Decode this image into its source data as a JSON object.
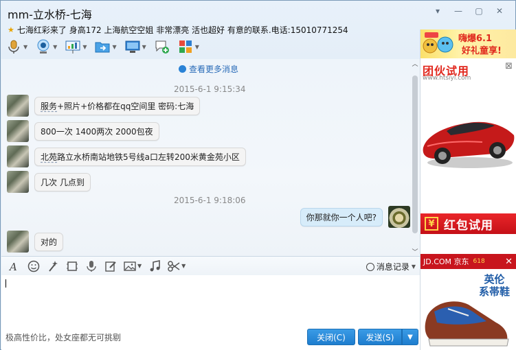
{
  "window": {
    "title": "mm-立水桥-七海",
    "controls": [
      "▾",
      "—",
      "▢",
      "✕"
    ]
  },
  "contact": {
    "signature": "七海红彩来了 身高172 上海航空空姐 非常漂亮 活也超好 有意的联系.电话:15010771254"
  },
  "toolbar": {
    "items": [
      "voice-call",
      "video-call",
      "share-screen",
      "send-file",
      "remote-desktop",
      "create-discussion",
      "apps"
    ]
  },
  "chat": {
    "more_messages": "查看更多消息",
    "timestamps": [
      "2015-6-1 9:15:34",
      "2015-6-1 9:18:06"
    ],
    "messages": [
      {
        "side": "left",
        "text_part1": "服务",
        "text_part2": "+照片+价格都在qq空间里 密码:七海"
      },
      {
        "side": "left",
        "text": "800一次 1400两次 2000包夜"
      },
      {
        "side": "left",
        "text_part1": "北苑",
        "text_part2": "路立水桥南站地铁5号线a口左转200米黄金苑小区"
      },
      {
        "side": "left",
        "text": "几次 几点到"
      },
      {
        "side": "right",
        "text": "你那就你一个人吧?"
      },
      {
        "side": "left",
        "text": "对的"
      }
    ]
  },
  "input_toolbar": {
    "history_label": "消息记录"
  },
  "bottom": {
    "ad_text": "极高性价比，处女座都无可挑剔",
    "close_label": "关闭(C)",
    "send_label": "发送(S)"
  },
  "ads": {
    "ad1_line1": "嗨爆6.1",
    "ad1_line2": "好礼童享!",
    "ad2_brand": "团伙试用",
    "ad2_url": "www.htsiyi.com",
    "ad2_bar_symbol": "¥",
    "ad2_bar_label": "红包试用",
    "ad3_header": "JD.COM 京东",
    "ad3_header_tag": "618",
    "ad3_brand_line1": "英伦",
    "ad3_brand_line2": "系帯鞋"
  },
  "colors": {
    "accent": "#1e7dce",
    "link": "#2a6bb8",
    "ad_red": "#e0291d"
  }
}
